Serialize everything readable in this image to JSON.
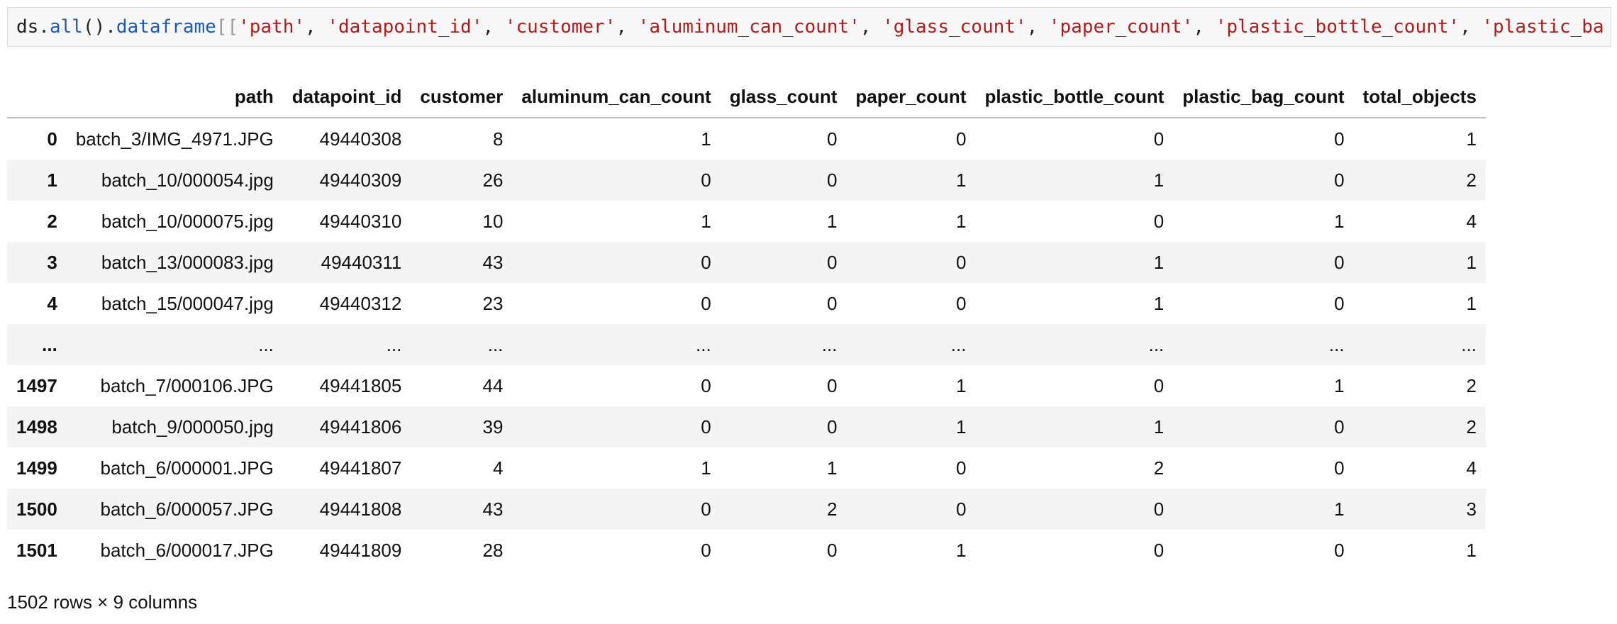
{
  "code": {
    "tokens": [
      {
        "t": "ds.",
        "c": "pun"
      },
      {
        "t": "all",
        "c": "fn"
      },
      {
        "t": "().",
        "c": "pun"
      },
      {
        "t": "dataframe",
        "c": "fn"
      },
      {
        "t": "[[",
        "c": "br"
      },
      {
        "t": "'path'",
        "c": "str"
      },
      {
        "t": ", ",
        "c": "pun"
      },
      {
        "t": "'datapoint_id'",
        "c": "str"
      },
      {
        "t": ", ",
        "c": "pun"
      },
      {
        "t": "'customer'",
        "c": "str"
      },
      {
        "t": ", ",
        "c": "pun"
      },
      {
        "t": "'aluminum_can_count'",
        "c": "str"
      },
      {
        "t": ", ",
        "c": "pun"
      },
      {
        "t": "'glass_count'",
        "c": "str"
      },
      {
        "t": ", ",
        "c": "pun"
      },
      {
        "t": "'paper_count'",
        "c": "str"
      },
      {
        "t": ", ",
        "c": "pun"
      },
      {
        "t": "'plastic_bottle_count'",
        "c": "str"
      },
      {
        "t": ", ",
        "c": "pun"
      },
      {
        "t": "'plastic_ba",
        "c": "str"
      }
    ]
  },
  "table": {
    "columns": [
      "",
      "path",
      "datapoint_id",
      "customer",
      "aluminum_can_count",
      "glass_count",
      "paper_count",
      "plastic_bottle_count",
      "plastic_bag_count",
      "total_objects"
    ],
    "rows": [
      [
        "0",
        "batch_3/IMG_4971.JPG",
        "49440308",
        "8",
        "1",
        "0",
        "0",
        "0",
        "0",
        "1"
      ],
      [
        "1",
        "batch_10/000054.jpg",
        "49440309",
        "26",
        "0",
        "0",
        "1",
        "1",
        "0",
        "2"
      ],
      [
        "2",
        "batch_10/000075.jpg",
        "49440310",
        "10",
        "1",
        "1",
        "1",
        "0",
        "1",
        "4"
      ],
      [
        "3",
        "batch_13/000083.jpg",
        "49440311",
        "43",
        "0",
        "0",
        "0",
        "1",
        "0",
        "1"
      ],
      [
        "4",
        "batch_15/000047.jpg",
        "49440312",
        "23",
        "0",
        "0",
        "0",
        "1",
        "0",
        "1"
      ],
      [
        "...",
        "...",
        "...",
        "...",
        "...",
        "...",
        "...",
        "...",
        "...",
        "..."
      ],
      [
        "1497",
        "batch_7/000106.JPG",
        "49441805",
        "44",
        "0",
        "0",
        "1",
        "0",
        "1",
        "2"
      ],
      [
        "1498",
        "batch_9/000050.jpg",
        "49441806",
        "39",
        "0",
        "0",
        "1",
        "1",
        "0",
        "2"
      ],
      [
        "1499",
        "batch_6/000001.JPG",
        "49441807",
        "4",
        "1",
        "1",
        "0",
        "2",
        "0",
        "4"
      ],
      [
        "1500",
        "batch_6/000057.JPG",
        "49441808",
        "43",
        "0",
        "2",
        "0",
        "0",
        "1",
        "3"
      ],
      [
        "1501",
        "batch_6/000017.JPG",
        "49441809",
        "28",
        "0",
        "0",
        "1",
        "0",
        "0",
        "1"
      ]
    ]
  },
  "footer": "1502 rows × 9 columns"
}
